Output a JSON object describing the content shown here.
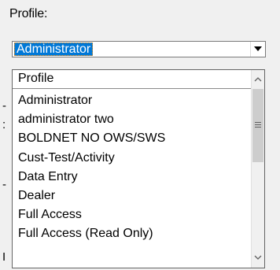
{
  "profile_label": "Profile:",
  "combo": {
    "selected": "Administrator"
  },
  "dropdown": {
    "header": "Profile",
    "items": [
      "Administrator",
      "administrator two",
      "BOLDNET NO OWS/SWS",
      "Cust-Test/Activity",
      "Data Entry",
      "Dealer",
      "Full Access",
      "Full Access (Read Only)"
    ]
  },
  "colors": {
    "selection": "#0078d7",
    "window": "#f0f0f0"
  },
  "icons": {
    "combo_arrow": "chevron-down-icon",
    "scroll_up": "chevron-up-icon",
    "scroll_down": "chevron-down-icon"
  }
}
